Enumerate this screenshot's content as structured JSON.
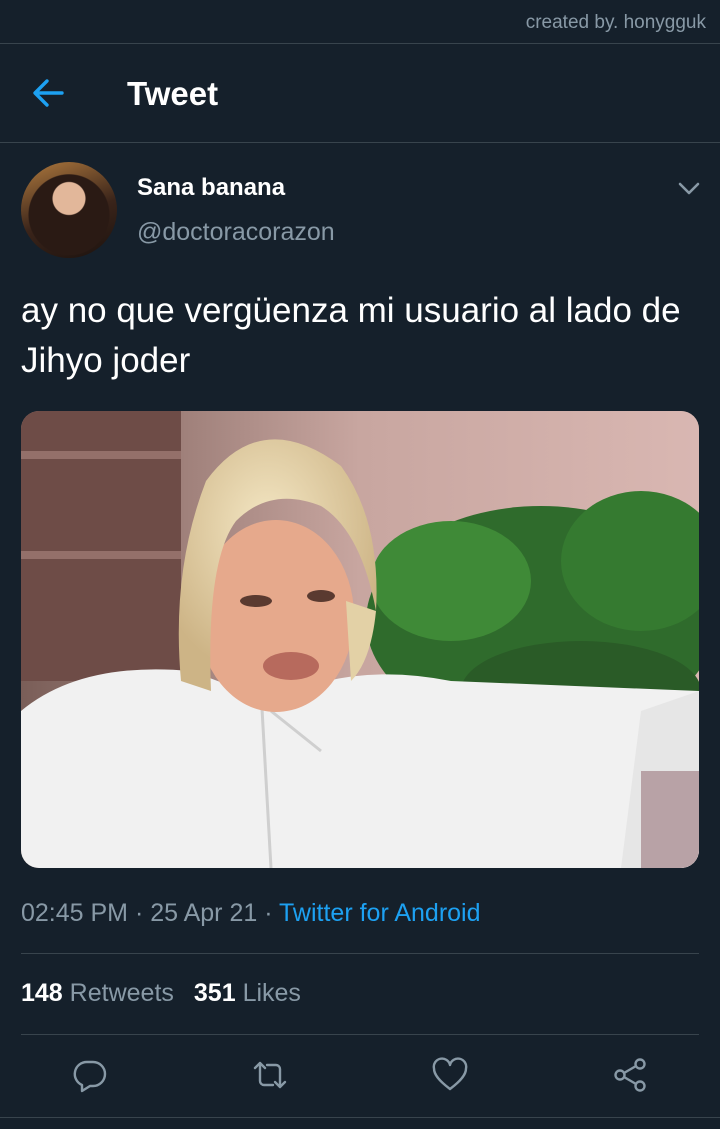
{
  "credit": "created by. honygguk",
  "header": {
    "title": "Tweet",
    "back_icon": "arrow-left-icon"
  },
  "tweet": {
    "display_name": "Sana banana",
    "handle": "@doctoracorazon",
    "text": "ay no que vergüenza mi usuario al lado de Jihyo joder",
    "time": "02:45 PM",
    "sep1": " · ",
    "date": "25 Apr 21",
    "sep2": " · ",
    "source": "Twitter for Android"
  },
  "stats": {
    "retweets_count": "148",
    "retweets_label": "Retweets",
    "likes_count": "351",
    "likes_label": "Likes"
  },
  "actions": [
    "reply-icon",
    "retweet-icon",
    "like-icon",
    "share-icon"
  ],
  "colors": {
    "background": "#15202b",
    "divider": "#38444d",
    "accent": "#1da1f2",
    "muted": "#8899a6"
  }
}
